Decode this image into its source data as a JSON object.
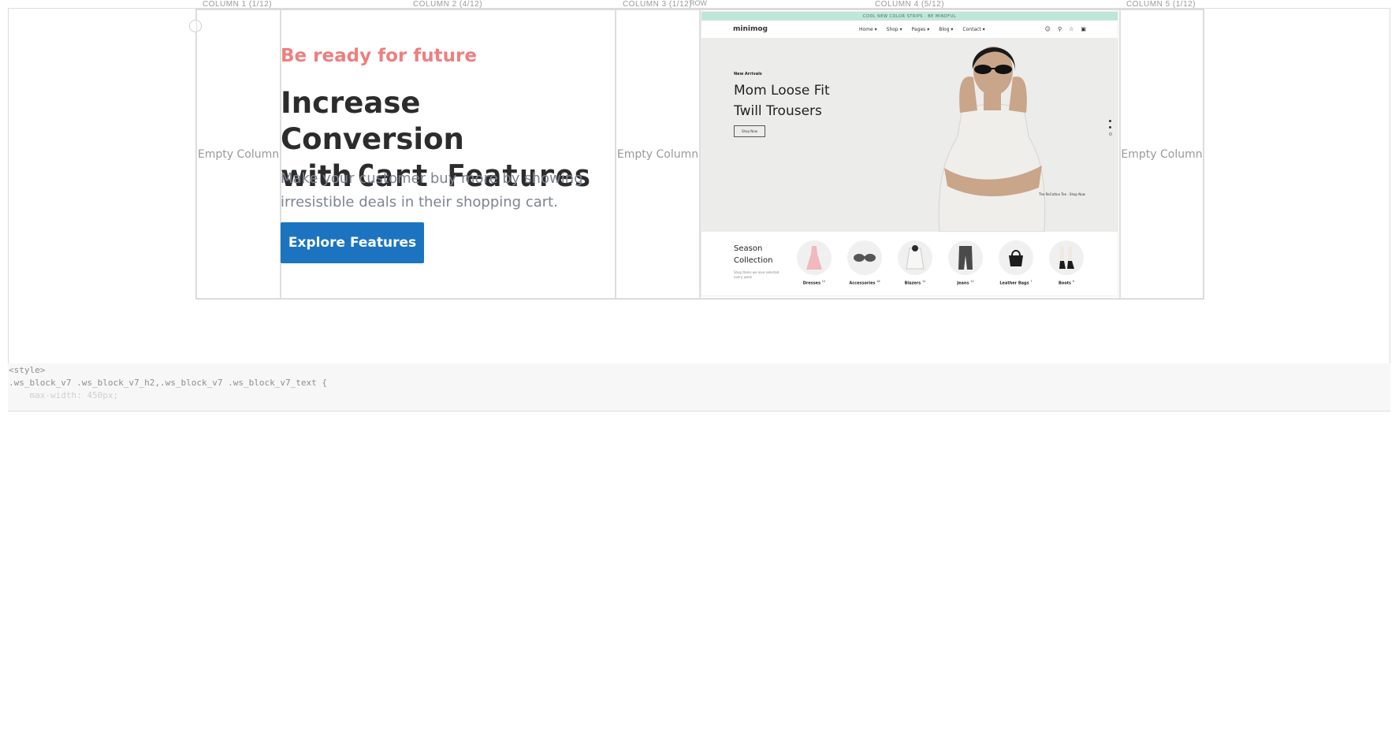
{
  "builder": {
    "column_labels": [
      "COLUMN 1 (1/12)",
      "COLUMN 2 (4/12)",
      "COLUMN 3 (1/12)",
      "COLUMN 4 (5/12)",
      "COLUMN 5 (1/12)"
    ],
    "row_label": "ROW",
    "empty_label": "Empty Column"
  },
  "hero": {
    "eyebrow": "Be ready for future",
    "headline_prefix": "Increase Conversion with",
    "headline_code": "Cart Features",
    "subtext": "Make your customer buy more by showing irresistible deals in their shopping cart.",
    "cta_label": "Explore Features"
  },
  "preview": {
    "announcement": "COOL NEW COLOR STRIPS · BE MINDFUL",
    "logo": "minimog",
    "nav": [
      "Home ▾",
      "Shop ▾",
      "Pages ▾",
      "Blog ▾",
      "Contact ▾"
    ],
    "hero_eyebrow": "New Arrivals",
    "hero_title": "Mom Loose Fit Twill Trousers",
    "hero_button": "Shop Now",
    "hero_caption": "The ReCotton Tee · Shop Now",
    "season_title": "Season Collection",
    "season_sub": "Shop Items we love selected every week",
    "categories": [
      {
        "name": "Dresses",
        "count": "12"
      },
      {
        "name": "Accessories",
        "count": "18"
      },
      {
        "name": "Blazers",
        "count": "12"
      },
      {
        "name": "Jeans",
        "count": "12"
      },
      {
        "name": "Leather Bags",
        "count": "7"
      },
      {
        "name": "Boots",
        "count": "9"
      }
    ],
    "colors": {
      "announcement_bg": "#bfe6da",
      "hero_bg": "#ececea"
    }
  },
  "code": {
    "line1": "<style>",
    "line2": ".ws_block_v7 .ws_block_v7_h2,.ws_block_v7 .ws_block_v7_text {",
    "line3": "    max-width: 450px;"
  },
  "colors": {
    "eyebrow": "#ee7f7f",
    "cta_bg": "#1c74c0",
    "headline": "#2c2c2c",
    "subtext": "#7d8591"
  }
}
